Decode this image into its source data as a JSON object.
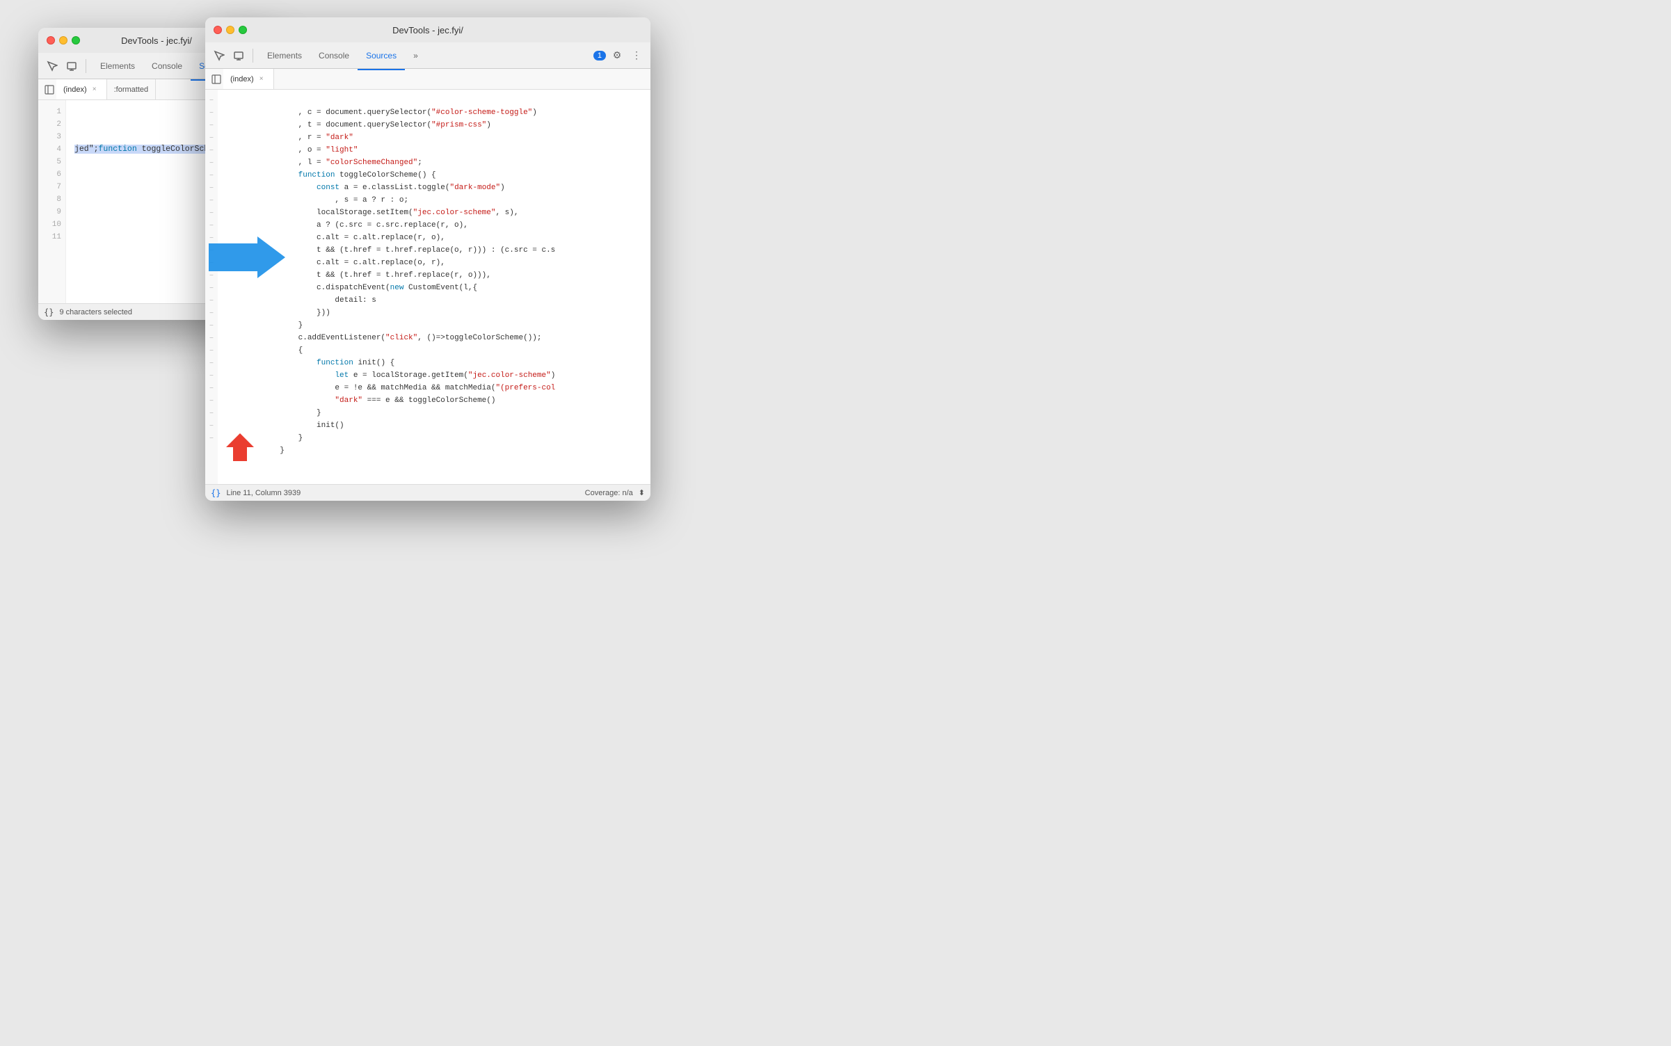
{
  "window1": {
    "title": "DevTools - jec.fyi/",
    "tabs": [
      "Elements",
      "Console",
      "Sources"
    ],
    "active_tab": "Sources",
    "file_tabs": [
      {
        "label": "(index)",
        "closeable": true
      },
      {
        "label": ":formatted",
        "closeable": false
      }
    ],
    "active_file_tab": "(index)",
    "line_numbers": [
      "1",
      "2",
      "3",
      "4",
      "5",
      "6",
      "7",
      "8",
      "9",
      "10",
      "11"
    ],
    "line11_content": "jed\";function toggleColorScheme(){const a=e",
    "status": "9 characters selected",
    "coverage": "Coverage: n/a",
    "format_btn": "{}"
  },
  "window2": {
    "title": "DevTools - jec.fyi/",
    "tabs": [
      "Elements",
      "Console",
      "Sources"
    ],
    "active_tab": "Sources",
    "badge": "1",
    "file_tabs": [
      {
        "label": "(index)",
        "closeable": true
      }
    ],
    "active_file_tab": "(index)",
    "code_lines": [
      {
        "bp": "-",
        "code": "                , c = document.querySelector(\"#color-scheme-toggle\")"
      },
      {
        "bp": "-",
        "code": "                , t = document.querySelector(\"#prism-css\")"
      },
      {
        "bp": "-",
        "code": "                , r = \"dark\""
      },
      {
        "bp": "-",
        "code": "                , o = \"light\""
      },
      {
        "bp": "-",
        "code": "                , l = \"colorSchemeChanged\";"
      },
      {
        "bp": "-",
        "code": "                function toggleColorScheme() {"
      },
      {
        "bp": "-",
        "code": "                    const a = e.classList.toggle(\"dark-mode\")"
      },
      {
        "bp": "-",
        "code": "                        , s = a ? r : o;"
      },
      {
        "bp": "-",
        "code": "                    localStorage.setItem(\"jec.color-scheme\", s),"
      },
      {
        "bp": "-",
        "code": "                    a ? (c.src = c.src.replace(r, o),"
      },
      {
        "bp": "-",
        "code": "                    c.alt = c.alt.replace(r, o),"
      },
      {
        "bp": "-",
        "code": "                    t && (t.href = t.href.replace(o, r))) : (c.src = c.s"
      },
      {
        "bp": "-",
        "code": "                    c.alt = c.alt.replace(o, r),"
      },
      {
        "bp": "-",
        "code": "                    t && (t.href = t.href.replace(r, o))),"
      },
      {
        "bp": "-",
        "code": "                    c.dispatchEvent(new CustomEvent(l,{"
      },
      {
        "bp": "-",
        "code": "                        detail: s"
      },
      {
        "bp": "-",
        "code": "                    }))"
      },
      {
        "bp": "-",
        "code": "                }"
      },
      {
        "bp": "-",
        "code": "                c.addEventListener(\"click\", ()=>toggleColorScheme());"
      },
      {
        "bp": "-",
        "code": "                {"
      },
      {
        "bp": "-",
        "code": "                    function init() {"
      },
      {
        "bp": "-",
        "code": "                        let e = localStorage.getItem(\"jec.color-scheme\")"
      },
      {
        "bp": "-",
        "code": "                        e = !e && matchMedia && matchMedia(\"(prefers-col"
      },
      {
        "bp": "-",
        "code": "                        \"dark\" === e && toggleColorScheme()"
      },
      {
        "bp": "-",
        "code": "                    }"
      },
      {
        "bp": "-",
        "code": "                    init()"
      },
      {
        "bp": "-",
        "code": "                }"
      },
      {
        "bp": "-",
        "code": "            }"
      }
    ],
    "status_line": "Line 11, Column 3939",
    "coverage": "Coverage: n/a",
    "format_btn": "{}"
  },
  "icons": {
    "inspect": "⬚",
    "device": "☐",
    "more": "»",
    "play_pause": "▶",
    "close": "×",
    "scroll": "⬍",
    "settings": "⚙",
    "more_vert": "⋮",
    "chat": "💬",
    "format": "{}"
  }
}
